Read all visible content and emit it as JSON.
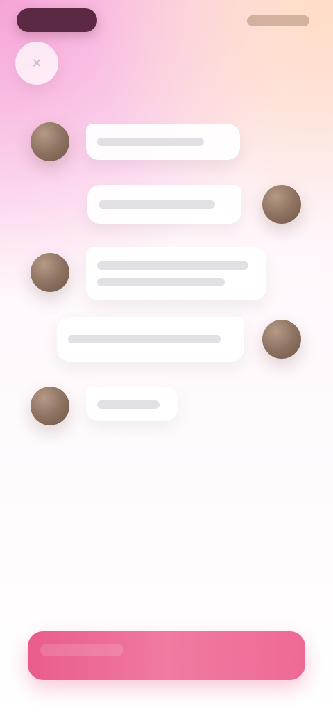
{
  "ui": {
    "close_icon": "close-icon"
  },
  "chat": {
    "messages": [
      {
        "side": "left",
        "text": ""
      },
      {
        "side": "right",
        "text": ""
      },
      {
        "side": "left",
        "text": ""
      },
      {
        "side": "right",
        "text": ""
      },
      {
        "side": "left",
        "text": ""
      }
    ]
  },
  "primary_action": {
    "label": ""
  },
  "colors": {
    "top_pill": "#5b2941",
    "cta_start": "#ea5c8b",
    "cta_end": "#ee6a95"
  }
}
